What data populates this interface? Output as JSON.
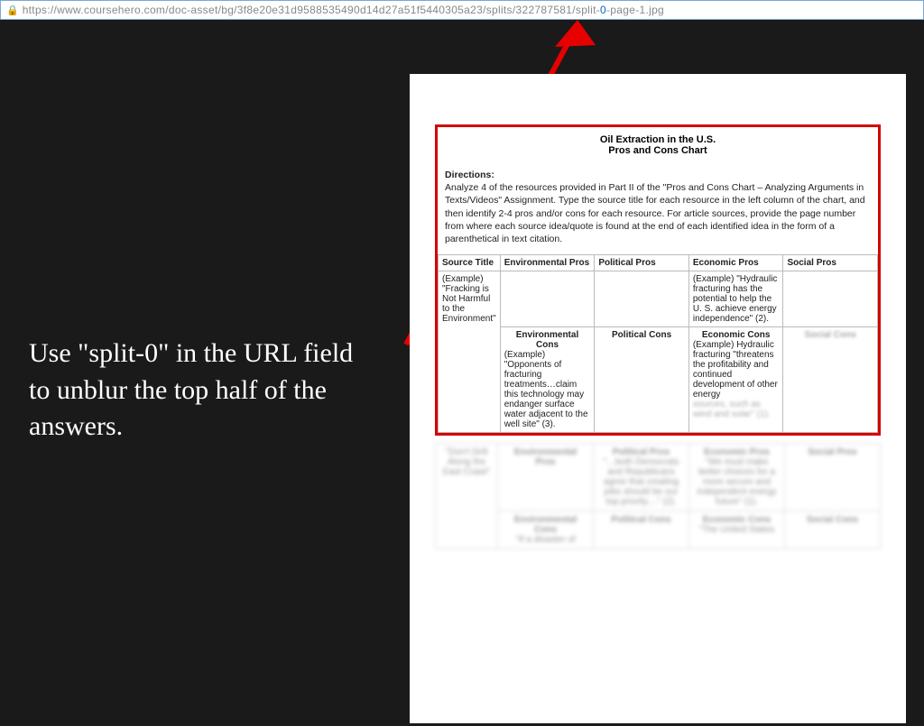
{
  "url_bar": {
    "url_prefix": "https://www.coursehero.com",
    "url_path": "/doc-asset/bg/3f8e20e31d9588535490d14d27a51f5440305a23/splits/322787581/split-",
    "url_highlight": "0",
    "url_suffix": "-page-1.jpg"
  },
  "instruction": "Use \"split-0\" in the URL field to unblur the top half of the answers.",
  "doc": {
    "title": "Oil Extraction in the U.S.",
    "subtitle": "Pros and Cons Chart",
    "directions_label": "Directions:",
    "directions_text": "Analyze 4 of the resources provided in Part II of the \"Pros and Cons Chart – Analyzing Arguments in Texts/Videos\" Assignment. Type the source title for each resource in the left column of the chart, and then identify 2-4 pros and/or cons for each resource.  For article sources, provide the page number from where each source idea/quote is found at the end of each identified idea in the form of a parenthetical in text citation.",
    "source_title_header": "Source Title",
    "headers_pros": {
      "env": "Environmental Pros",
      "pol": "Political Pros",
      "econ": "Economic Pros",
      "soc": "Social Pros"
    },
    "headers_cons": {
      "env": "Environmental Cons",
      "pol": "Political Cons",
      "econ": "Economic Cons",
      "soc": "Social Cons"
    },
    "example_source": "(Example) \"Fracking is Not Harmful to the Environment\"",
    "pros_cells": {
      "env": "",
      "pol": "",
      "econ": "(Example) \"Hydraulic fracturing has the potential to help the U. S. achieve energy independence\" (2).",
      "soc": ""
    },
    "cons_cells": {
      "env": "(Example) \"Opponents of fracturing treatments…claim this technology may endanger surface water adjacent to the well site\" (3).",
      "pol": "",
      "econ_clear": "(Example) Hydraulic fracturing \"threatens the profitability and continued development of other energy",
      "econ_blur": "sources, such as wind and solar\" (1).",
      "soc_blur": "Social Cons"
    }
  },
  "blurred": {
    "row1_src": "\"Don't Drill Along the East Coast\"",
    "row1_env": "Environmental Pros",
    "row1_pol_h": "Political Pros",
    "row1_pol": "\"…both Democrats and Republicans agree that creating jobs should be our top priority…\" (2).",
    "row1_econ_h": "Economic Pros",
    "row1_econ": "\"We must make better choices for a more secure and independent energy future\" (1).",
    "row1_soc": "Social Pros",
    "row2_env_h": "Environmental Cons",
    "row2_env": "\"If a disaster of",
    "row2_pol": "Political Cons",
    "row2_econ_h": "Economic Cons",
    "row2_econ": "\"The United States",
    "row2_soc": "Social Cons"
  }
}
